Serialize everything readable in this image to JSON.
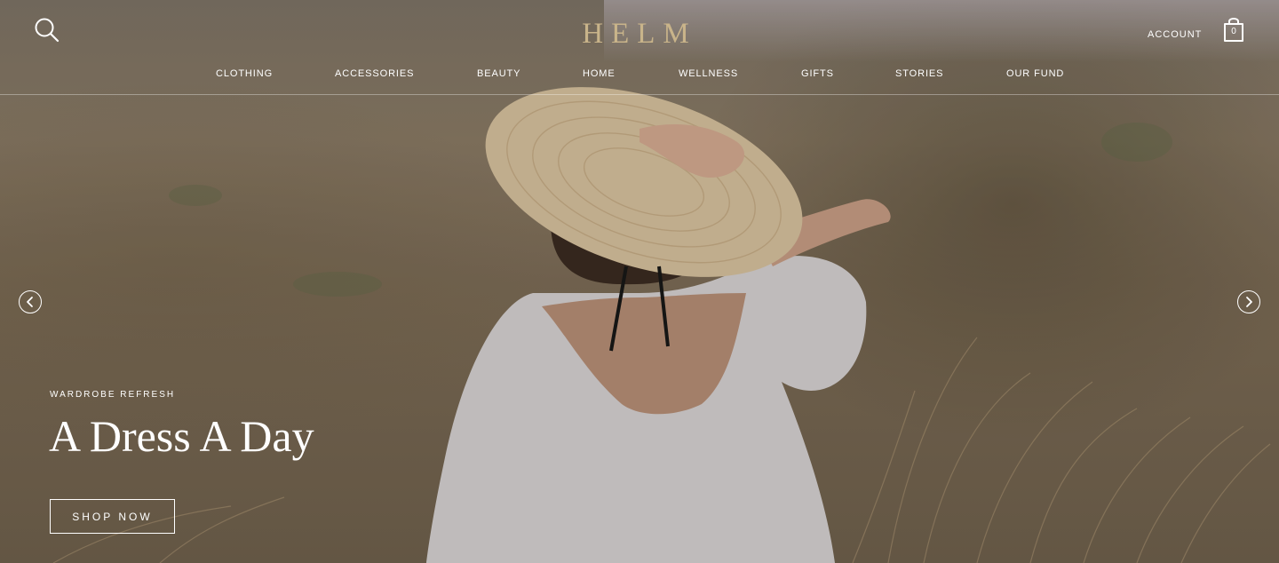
{
  "header": {
    "logo": "HELM",
    "account_label": "ACCOUNT",
    "bag_count": "0",
    "icons": {
      "search": "search-icon",
      "bag": "shopping-bag-icon"
    }
  },
  "nav": {
    "items": [
      {
        "label": "CLOTHING"
      },
      {
        "label": "ACCESSORIES"
      },
      {
        "label": "BEAUTY"
      },
      {
        "label": "HOME"
      },
      {
        "label": "WELLNESS"
      },
      {
        "label": "GIFTS"
      },
      {
        "label": "STORIES"
      },
      {
        "label": "OUR FUND"
      }
    ]
  },
  "hero": {
    "eyebrow": "WARDROBE REFRESH",
    "headline": "A Dress A Day",
    "cta_label": "SHOP NOW",
    "icons": {
      "prev": "chevron-left-icon",
      "next": "chevron-right-icon"
    }
  },
  "colors": {
    "logo": "#c9b48a",
    "text": "#ffffff"
  }
}
